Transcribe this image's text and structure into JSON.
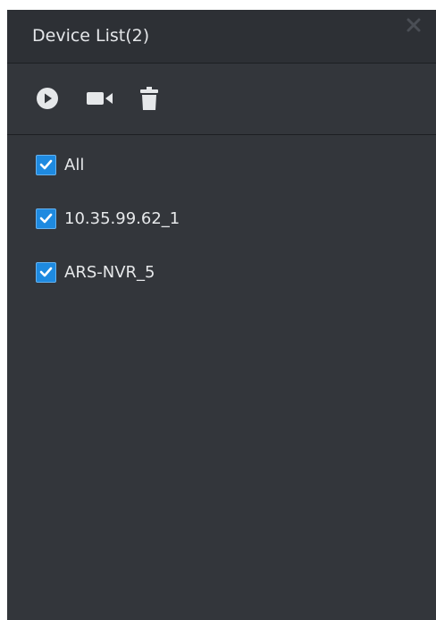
{
  "window": {
    "title": "Device List(2)",
    "close_icon": "close-icon"
  },
  "toolbar": {
    "buttons": [
      {
        "icon": "play-icon"
      },
      {
        "icon": "video-camera-icon"
      },
      {
        "icon": "trash-icon"
      }
    ]
  },
  "devices": {
    "items": [
      {
        "label": "All",
        "checked": true
      },
      {
        "label": "10.35.99.62_1",
        "checked": true
      },
      {
        "label": "ARS-NVR_5",
        "checked": true
      }
    ]
  },
  "colors": {
    "panel_bg": "#33363b",
    "titlebar_bg": "#2d3035",
    "checkbox_accent": "#1e8ae0",
    "text": "#e6e8ea"
  }
}
